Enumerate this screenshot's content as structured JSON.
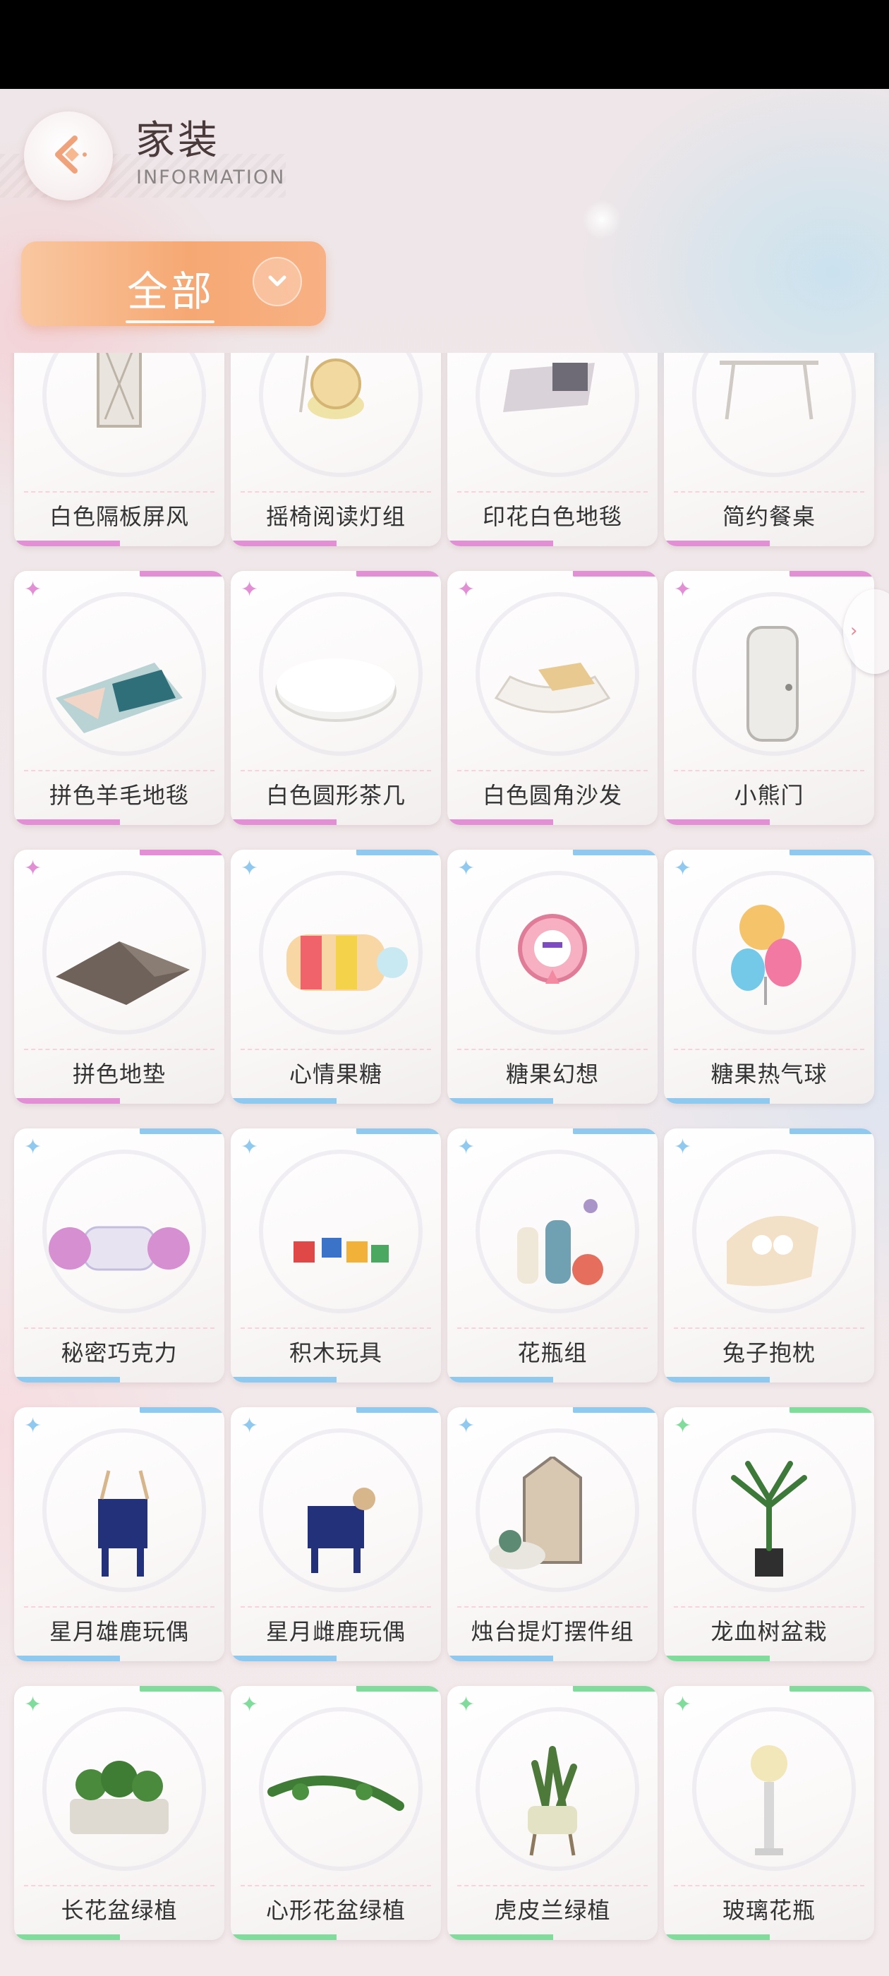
{
  "header": {
    "title": "家装",
    "subtitle": "INFORMATION",
    "back_icon": "arrow-left-icon"
  },
  "filter": {
    "label": "全部",
    "icon": "chevron-down-icon"
  },
  "colors": {
    "accent_orange": "#f6a873",
    "rarity_pink": "#e28fd6",
    "rarity_blue": "#8fc9f0",
    "rarity_green": "#7fdc9a",
    "text_dark": "#333333"
  },
  "items": [
    {
      "name": "白色隔板屏风",
      "rarity": "pink"
    },
    {
      "name": "摇椅阅读灯组",
      "rarity": "pink"
    },
    {
      "name": "印花白色地毯",
      "rarity": "pink"
    },
    {
      "name": "简约餐桌",
      "rarity": "pink"
    },
    {
      "name": "拼色羊毛地毯",
      "rarity": "pink"
    },
    {
      "name": "白色圆形茶几",
      "rarity": "pink"
    },
    {
      "name": "白色圆角沙发",
      "rarity": "pink"
    },
    {
      "name": "小熊门",
      "rarity": "pink"
    },
    {
      "name": "拼色地垫",
      "rarity": "pink"
    },
    {
      "name": "心情果糖",
      "rarity": "blue"
    },
    {
      "name": "糖果幻想",
      "rarity": "blue"
    },
    {
      "name": "糖果热气球",
      "rarity": "blue"
    },
    {
      "name": "秘密巧克力",
      "rarity": "blue"
    },
    {
      "name": "积木玩具",
      "rarity": "blue"
    },
    {
      "name": "花瓶组",
      "rarity": "blue"
    },
    {
      "name": "兔子抱枕",
      "rarity": "blue"
    },
    {
      "name": "星月雄鹿玩偶",
      "rarity": "blue"
    },
    {
      "name": "星月雌鹿玩偶",
      "rarity": "blue"
    },
    {
      "name": "烛台提灯摆件组",
      "rarity": "blue"
    },
    {
      "name": "龙血树盆栽",
      "rarity": "green"
    },
    {
      "name": "长花盆绿植",
      "rarity": "green"
    },
    {
      "name": "心形花盆绿植",
      "rarity": "green"
    },
    {
      "name": "虎皮兰绿植",
      "rarity": "green"
    },
    {
      "name": "玻璃花瓶",
      "rarity": "green"
    }
  ]
}
